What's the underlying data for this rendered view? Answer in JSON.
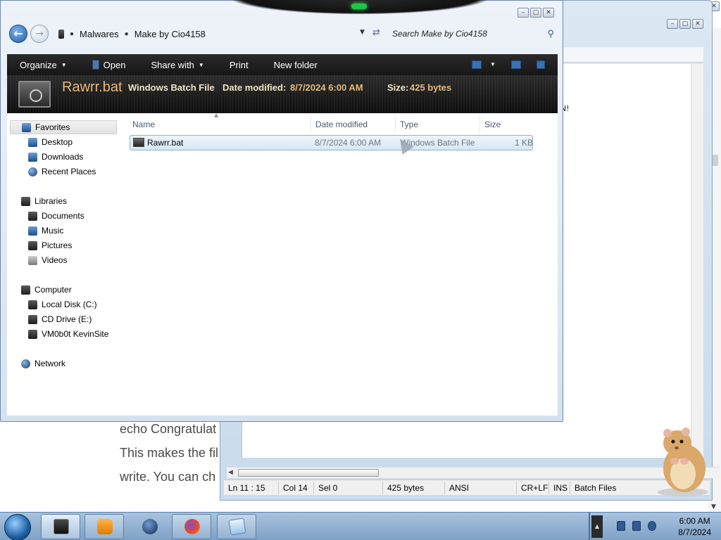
{
  "background_page": {
    "lines": [
      "echo Congratulat",
      "This makes the fil",
      "write. You can ch"
    ]
  },
  "notepad": {
    "edit_fragment": "N!",
    "status": {
      "position": "Ln 11 : 15",
      "column": "Col 14",
      "selection": "Sel 0",
      "size": "425 bytes",
      "encoding": "ANSI",
      "line_endings": "CR+LF",
      "mode": "INS",
      "language": "Batch Files"
    }
  },
  "explorer": {
    "breadcrumb": [
      "Malwares",
      "Make by Cio4158"
    ],
    "search_placeholder": "Search Make by Cio4158",
    "commands": {
      "organize": "Organize",
      "open": "Open",
      "share": "Share with",
      "print": "Print",
      "new_folder": "New folder"
    },
    "details": {
      "name": "Rawrr.bat",
      "type": "Windows Batch File",
      "modified_label": "Date modified:",
      "modified_value": "8/7/2024 6:00 AM",
      "size_label": "Size:",
      "size_value": "425 bytes"
    },
    "nav": {
      "favorites": "Favorites",
      "desktop": "Desktop",
      "downloads": "Downloads",
      "recent": "Recent Places",
      "libraries": "Libraries",
      "documents": "Documents",
      "music": "Music",
      "pictures": "Pictures",
      "videos": "Videos",
      "computer": "Computer",
      "local_disk": "Local Disk (C:)",
      "cd_drive": "CD Drive (E:)",
      "vmshare": "VM0b0t KevinSite",
      "network": "Network"
    },
    "columns": {
      "name": "Name",
      "date": "Date modified",
      "type": "Type",
      "size": "Size"
    },
    "files": [
      {
        "name": "Rawrr.bat",
        "date": "8/7/2024 6:00 AM",
        "type": "Windows Batch File",
        "size": "1 KB"
      }
    ]
  },
  "taskbar": {
    "clock_time": "6:00 AM",
    "clock_date": "8/7/2024",
    "pinned": [
      "cmd-icon",
      "media-player-icon",
      "globe-icon",
      "firefox-icon",
      "notepad-icon"
    ]
  },
  "colors": {
    "details_accent": "#e8b978",
    "taskbar": "#7fa1c6",
    "selection": "#d6e7f5"
  }
}
